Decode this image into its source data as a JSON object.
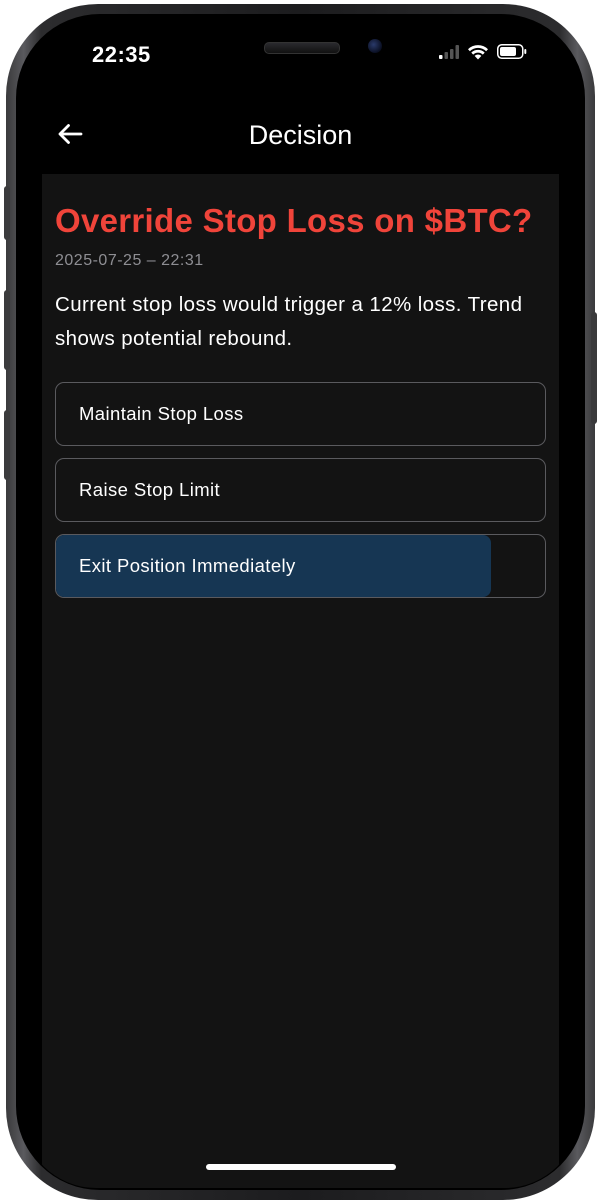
{
  "status_bar": {
    "time": "22:35",
    "signal_icon": "cellular-signal-icon",
    "wifi_icon": "wifi-icon",
    "battery_icon": "battery-icon"
  },
  "nav": {
    "back_icon": "arrow-left-icon",
    "title": "Decision"
  },
  "decision": {
    "title": "Override Stop Loss on $BTC?",
    "timestamp": "2025-07-25 – 22:31",
    "description": "Current stop loss would trigger a 12% loss. Trend shows potential rebound."
  },
  "options": [
    {
      "label": "Maintain Stop Loss",
      "fill_percent": 0
    },
    {
      "label": "Raise Stop Limit",
      "fill_percent": 0
    },
    {
      "label": "Exit Position Immediately",
      "fill_percent": 89
    }
  ],
  "colors": {
    "title_accent": "#f0443a",
    "selected_fill": "#163653",
    "background": "#131313"
  }
}
